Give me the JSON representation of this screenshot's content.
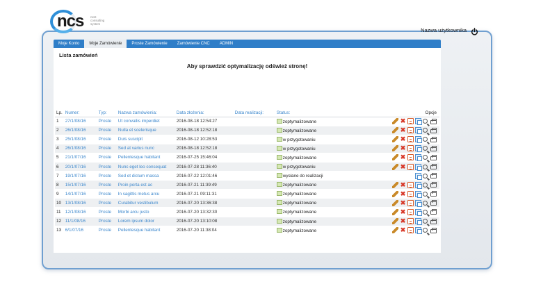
{
  "logo": {
    "brand": "ncs",
    "tagline": "nest consulting system"
  },
  "user": {
    "name": "Nazwa użytkownika",
    "logout_icon": "power-icon"
  },
  "tabs": [
    {
      "label": "Moje Konto",
      "active": false
    },
    {
      "label": "Moje Zamówienie",
      "active": true
    },
    {
      "label": "Proste Zamówienie",
      "active": false
    },
    {
      "label": "Zamówienie CNC",
      "active": false
    },
    {
      "label": "ADMIN",
      "active": false
    }
  ],
  "panel": {
    "title": "Lista zamówień",
    "notice": "Aby sprawdzić optymalizację odśwież stronę!"
  },
  "table": {
    "headers": {
      "lp": "Lp.",
      "number": "Numer:",
      "type": "Typ:",
      "name": "Nazwa zamówienia:",
      "created": "Data złożenia:",
      "realized": "Data realizacji:",
      "status": "Status:",
      "options": "Opcje"
    },
    "rows": [
      {
        "lp": "1",
        "number": "27/1/08/16",
        "type": "Proste",
        "name": "Ut convallis imperdiet",
        "created": "2016-08-18 12:54:27",
        "realized": "",
        "status": "zoptymalizowane",
        "actions": [
          "pencil-icon",
          "delete-icon",
          "document-icon",
          "copy-icon",
          "zoom-icon",
          "print-icon"
        ]
      },
      {
        "lp": "2",
        "number": "26/1/08/16",
        "type": "Proste",
        "name": "Nulla et scelerisque",
        "created": "2016-08-18 12:52:18",
        "realized": "",
        "status": "zoptymalizowane",
        "actions": [
          "pencil-icon",
          "delete-icon",
          "document-icon",
          "copy-icon",
          "zoom-icon",
          "print-icon"
        ]
      },
      {
        "lp": "3",
        "number": "25/1/08/16",
        "type": "Proste",
        "name": "Duis suscipit",
        "created": "2016-08-12 10:28:53",
        "realized": "",
        "status": "w przygotowaniu",
        "actions": [
          "pencil-icon",
          "delete-icon",
          "document-icon",
          "copy-icon",
          "zoom-icon",
          "print-icon"
        ]
      },
      {
        "lp": "4",
        "number": "26/1/08/16",
        "type": "Proste",
        "name": "Sed at varius nunc",
        "created": "2016-08-18 12:52:18",
        "realized": "",
        "status": "w przygotowaniu",
        "actions": [
          "pencil-icon",
          "delete-icon",
          "document-icon",
          "copy-icon",
          "zoom-icon",
          "print-icon"
        ]
      },
      {
        "lp": "5",
        "number": "21/1/07/16",
        "type": "Proste",
        "name": "Pellentesque habitant",
        "created": "2016-07-25 15:46:04",
        "realized": "",
        "status": "zoptymalizowane",
        "actions": [
          "pencil-icon",
          "delete-icon",
          "document-icon",
          "copy-icon",
          "zoom-icon",
          "print-icon"
        ]
      },
      {
        "lp": "6",
        "number": "20/1/07/16",
        "type": "Proste",
        "name": "Nunc eget leo consequat",
        "created": "2016-07-28 11:36:40",
        "realized": "",
        "status": "w przygotowaniu",
        "actions": [
          "pencil-icon",
          "delete-icon",
          "document-icon",
          "copy-icon",
          "zoom-icon",
          "print-icon"
        ]
      },
      {
        "lp": "7",
        "number": "19/1/07/16",
        "type": "Proste",
        "name": "Sed et dictum massa",
        "created": "2016-07-22 12:01:46",
        "realized": "",
        "status": "wysłane do realizacji",
        "actions": [
          "copy-icon",
          "zoom-icon",
          "print-icon"
        ]
      },
      {
        "lp": "8",
        "number": "15/1/07/16",
        "type": "Proste",
        "name": "Proin porta est ac",
        "created": "2016-07-21 11:39:49",
        "realized": "",
        "status": "zoptymalizowane",
        "actions": [
          "pencil-icon",
          "delete-icon",
          "document-icon",
          "copy-icon",
          "zoom-icon",
          "print-icon"
        ]
      },
      {
        "lp": "9",
        "number": "14/1/07/16",
        "type": "Proste",
        "name": "In sagittis metus arcu",
        "created": "2016-07-21 09:11:31",
        "realized": "",
        "status": "zoptymalizowane",
        "actions": [
          "pencil-icon",
          "delete-icon",
          "document-icon",
          "copy-icon",
          "zoom-icon",
          "print-icon"
        ]
      },
      {
        "lp": "10",
        "number": "13/1/08/16",
        "type": "Proste",
        "name": "Curabitur vestibulum",
        "created": "2016-07-20 13:36:38",
        "realized": "",
        "status": "zoptymalizowane",
        "actions": [
          "pencil-icon",
          "delete-icon",
          "document-icon",
          "copy-icon",
          "zoom-icon",
          "print-icon"
        ]
      },
      {
        "lp": "11",
        "number": "12/1/08/16",
        "type": "Proste",
        "name": "Morbi arcu justo",
        "created": "2016-07-20 13:32:30",
        "realized": "",
        "status": "zoptymalizowane",
        "actions": [
          "pencil-icon",
          "delete-icon",
          "document-icon",
          "copy-icon",
          "zoom-icon",
          "print-icon"
        ]
      },
      {
        "lp": "12",
        "number": "11/1/08/16",
        "type": "Proste",
        "name": "Lorem ipsum dolor",
        "created": "2016-07-20 13:10:08",
        "realized": "",
        "status": "zoptymalizowane",
        "actions": [
          "pencil-icon",
          "delete-icon",
          "document-icon",
          "copy-icon",
          "zoom-icon",
          "print-icon"
        ]
      },
      {
        "lp": "13",
        "number": "6/1/07/16",
        "type": "Proste",
        "name": "Pellentesque habitant",
        "created": "2016-07-20 11:38:04",
        "realized": "",
        "status": "zoptymalizowane",
        "actions": [
          "pencil-icon",
          "delete-icon",
          "document-icon",
          "copy-icon",
          "zoom-icon",
          "print-icon"
        ]
      }
    ]
  },
  "colors": {
    "accent": "#2f7ec8",
    "link": "#3a86cc",
    "frame_border": "#6f9fd0",
    "delete": "#d83a2a"
  }
}
